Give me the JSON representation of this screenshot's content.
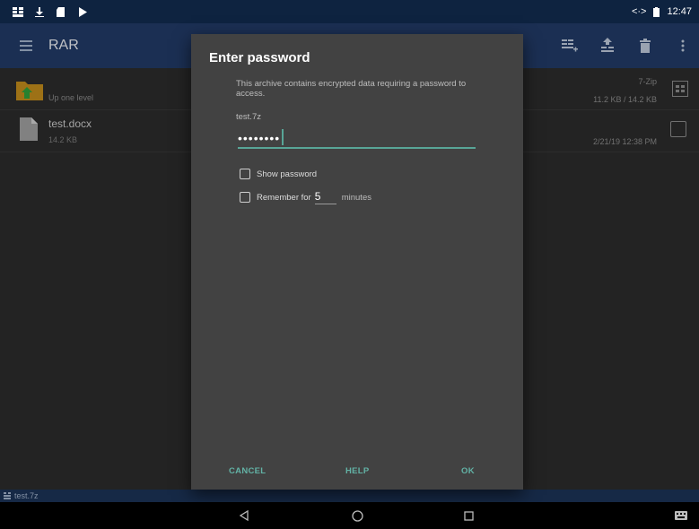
{
  "status_bar": {
    "time": "12:47",
    "icons": [
      "grid-icon",
      "download-icon",
      "sim-icon",
      "play-store-icon"
    ]
  },
  "app_bar": {
    "title": "RAR",
    "actions": [
      "add-to-archive-icon",
      "extract-icon",
      "delete-icon",
      "more-vert-icon"
    ]
  },
  "file_list": {
    "up_level": {
      "label": "Up one level",
      "type_label": "7-Zip",
      "size_label": "11.2 KB / 14.2 KB"
    },
    "files": [
      {
        "name": "test.docx",
        "size": "14.2 KB",
        "date": "2/21/19 12:38 PM"
      }
    ]
  },
  "bottom_bar": {
    "path": "test.7z"
  },
  "dialog": {
    "title": "Enter password",
    "message": "This archive contains encrypted data requiring a password to access.",
    "archive_name": "test.7z",
    "password_value": "••••••••",
    "show_password_label": "Show password",
    "remember_label": "Remember for",
    "remember_value": "5",
    "minutes_label": "minutes",
    "cancel_label": "CANCEL",
    "help_label": "HELP",
    "ok_label": "OK"
  },
  "colors": {
    "app_bar": "#213a66",
    "status_bar": "#0e2340",
    "accent": "#58a597",
    "dialog_bg": "#424242"
  }
}
